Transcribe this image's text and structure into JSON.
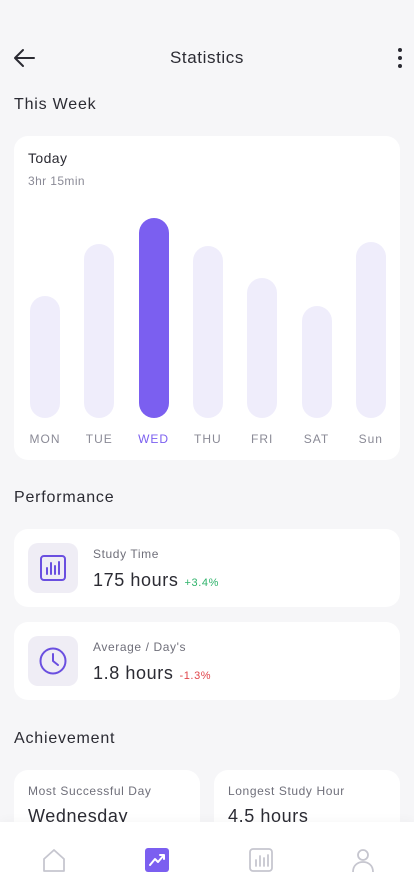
{
  "header": {
    "title": "Statistics",
    "back_icon": "arrow-left-icon",
    "menu_icon": "more-vertical-icon"
  },
  "this_week": {
    "heading": "This Week",
    "today_label": "Today",
    "today_value": "3hr 15min"
  },
  "chart_data": {
    "type": "bar",
    "categories": [
      "MON",
      "TUE",
      "WED",
      "THU",
      "FRI",
      "SAT",
      "Sun"
    ],
    "values": [
      0.61,
      0.87,
      1.0,
      0.86,
      0.7,
      0.56,
      0.88
    ],
    "highlighted": "WED",
    "colors": {
      "bar": "#efedfb",
      "active": "#7b5ff0"
    }
  },
  "performance": {
    "heading": "Performance",
    "items": [
      {
        "label": "Study Time",
        "value": "175 hours",
        "change": "+3.4%",
        "trend": "up",
        "icon": "bar-chart-icon"
      },
      {
        "label": "Average / Day's",
        "value": "1.8 hours",
        "change": "-1.3%",
        "trend": "down",
        "icon": "clock-icon"
      }
    ]
  },
  "achievement": {
    "heading": "Achievement",
    "items": [
      {
        "label": "Most Successful Day",
        "value": "Wednesday"
      },
      {
        "label": "Longest Study Hour",
        "value": "4.5 hours"
      }
    ]
  },
  "tabbar": {
    "tabs": [
      {
        "icon": "home-icon",
        "active": false
      },
      {
        "icon": "trending-chart-icon",
        "active": true
      },
      {
        "icon": "report-icon",
        "active": false
      },
      {
        "icon": "profile-icon",
        "active": false
      }
    ],
    "accent": "#7b5ff0",
    "inactive": "#c6c6cf"
  }
}
